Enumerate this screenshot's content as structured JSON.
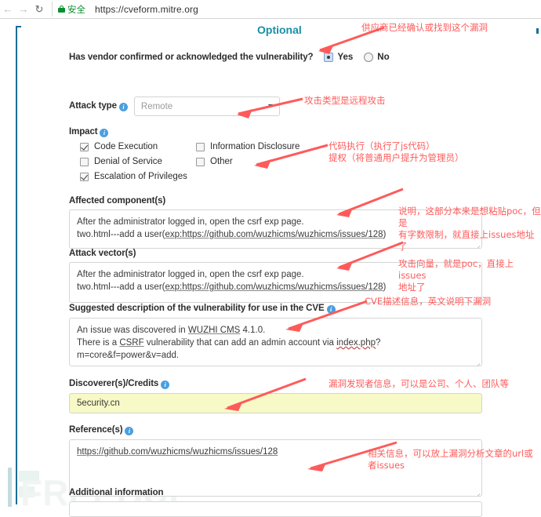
{
  "browser": {
    "back_icon": "arrow-left-icon",
    "forward_icon": "arrow-right-icon",
    "reload_icon": "reload-icon",
    "lock_icon": "lock-icon",
    "secure_label": "安全",
    "url_separator": "|",
    "url": "https://cveform.mitre.org"
  },
  "form": {
    "optional_title": "Optional",
    "vendor": {
      "label": "Has vendor confirmed or acknowledged the vulnerability?",
      "options": [
        {
          "label": "Yes",
          "checked": true
        },
        {
          "label": "No",
          "checked": false
        }
      ]
    },
    "attack_type": {
      "label": "Attack type",
      "info_icon": "info-icon",
      "value": "Remote",
      "caret_icon": "chevron-down-icon"
    },
    "impact": {
      "label": "Impact",
      "info_icon": "info-icon",
      "items": [
        {
          "label": "Code Execution",
          "checked": true
        },
        {
          "label": "Information Disclosure",
          "checked": false
        },
        {
          "label": "Denial of Service",
          "checked": false
        },
        {
          "label": "Other",
          "checked": false
        },
        {
          "label": "Escalation of Privileges",
          "checked": true
        }
      ]
    },
    "affected_component": {
      "label": "Affected component(s)",
      "line1": "After the administrator logged in, open the csrf exp page.",
      "line2_pre": "two.html---add a user(",
      "line2_link": "exp:https://github.com/wuzhicms/wuzhicms/issues/128",
      "line2_post": ")"
    },
    "attack_vector": {
      "label": "Attack vector(s)",
      "line1": "After the administrator logged in, open the csrf exp page.",
      "line2_pre": "two.html---add a user(",
      "line2_link": "exp:https://github.com/wuzhicms/wuzhicms/issues/128",
      "line2_post": ")"
    },
    "suggested_description": {
      "label": "Suggested description of the vulnerability for use in the CVE",
      "info_icon": "info-icon",
      "line1_pre": "An issue was discovered in ",
      "line1_mid": "WUZHI CMS",
      "line1_post": " 4.1.0.",
      "line2_pre": "There is a ",
      "line2_mid": "CSRF",
      "line2_mid2": " vulnerability that can add an admin account via ",
      "line2_link": "index.php",
      "line2_post": "?m=core&f=power&v=add."
    },
    "discoverer": {
      "label": "Discoverer(s)/Credits",
      "info_icon": "info-icon",
      "value": "5ecurity.cn"
    },
    "references": {
      "label": "Reference(s)",
      "info_icon": "info-icon",
      "value": "https://github.com/wuzhicms/wuzhicms/issues/128"
    },
    "additional_information": {
      "label": "Additional information"
    }
  },
  "annotations": {
    "vendor": "供应商已经确认或找到这个漏洞",
    "attack_type": "攻击类型是远程攻击",
    "impact": "代码执行（执行了js代码）\n提权（将普通用户提升为管理员）",
    "affected_component": "说明，这部分本来是想粘贴poc，但是\n有字数限制，就直接上issues地址了",
    "attack_vector": "攻击向量，就是poc，直接上issues\n地址了",
    "suggested_description": "CVE描述信息，英文说明下漏洞",
    "discoverer": "漏洞发现者信息，可以是公司、个人、团队等",
    "references": "相关信息，可以放上漏洞分析文章的url或\n者issues"
  },
  "watermark": {
    "text": "FREEBUF"
  },
  "colors": {
    "teal": "#1b6e96",
    "optional_title": "#178fa5",
    "annotation_red": "#ff5a5a",
    "secure_green": "#0a8f2e",
    "autofill_yellow": "#f7f9c6",
    "info_blue": "#4a9fe0"
  }
}
